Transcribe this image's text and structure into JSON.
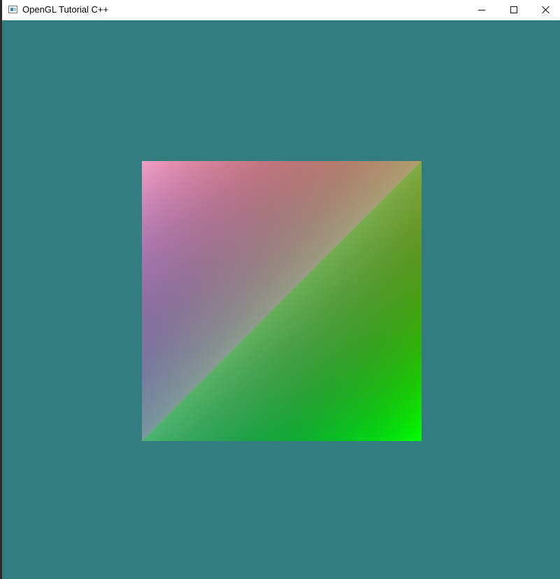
{
  "window": {
    "title": "OpenGL Tutorial C++",
    "controls": {
      "minimize_icon": "minimize-icon",
      "maximize_icon": "maximize-icon",
      "close_icon": "close-icon"
    }
  },
  "viewport": {
    "clear_color": "#337c7f",
    "quad": {
      "corner_colors": {
        "top_left": "#f2a0c4",
        "top_right": "#ff0000",
        "bottom_left": "#0000ff",
        "bottom_right": "#00ff00"
      },
      "diagonal_color": "#7fcf70"
    }
  }
}
